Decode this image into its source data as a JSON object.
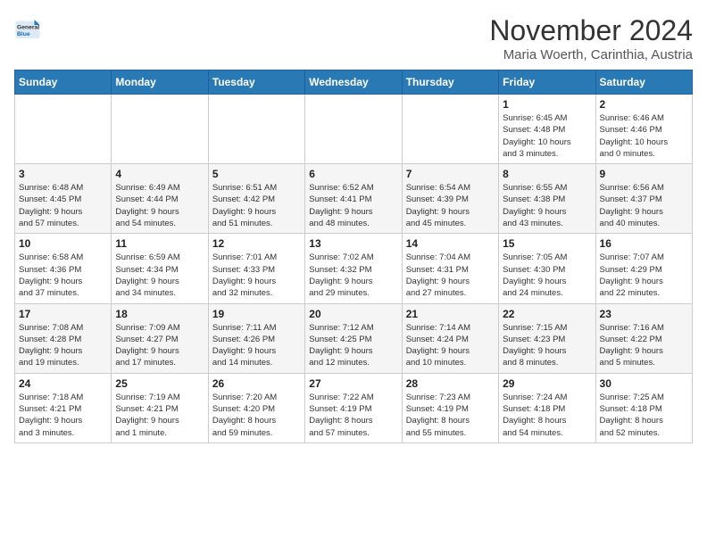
{
  "header": {
    "logo_general": "General",
    "logo_blue": "Blue",
    "month_title": "November 2024",
    "location": "Maria Woerth, Carinthia, Austria"
  },
  "days_of_week": [
    "Sunday",
    "Monday",
    "Tuesday",
    "Wednesday",
    "Thursday",
    "Friday",
    "Saturday"
  ],
  "weeks": [
    [
      {
        "day": "",
        "info": ""
      },
      {
        "day": "",
        "info": ""
      },
      {
        "day": "",
        "info": ""
      },
      {
        "day": "",
        "info": ""
      },
      {
        "day": "",
        "info": ""
      },
      {
        "day": "1",
        "info": "Sunrise: 6:45 AM\nSunset: 4:48 PM\nDaylight: 10 hours\nand 3 minutes."
      },
      {
        "day": "2",
        "info": "Sunrise: 6:46 AM\nSunset: 4:46 PM\nDaylight: 10 hours\nand 0 minutes."
      }
    ],
    [
      {
        "day": "3",
        "info": "Sunrise: 6:48 AM\nSunset: 4:45 PM\nDaylight: 9 hours\nand 57 minutes."
      },
      {
        "day": "4",
        "info": "Sunrise: 6:49 AM\nSunset: 4:44 PM\nDaylight: 9 hours\nand 54 minutes."
      },
      {
        "day": "5",
        "info": "Sunrise: 6:51 AM\nSunset: 4:42 PM\nDaylight: 9 hours\nand 51 minutes."
      },
      {
        "day": "6",
        "info": "Sunrise: 6:52 AM\nSunset: 4:41 PM\nDaylight: 9 hours\nand 48 minutes."
      },
      {
        "day": "7",
        "info": "Sunrise: 6:54 AM\nSunset: 4:39 PM\nDaylight: 9 hours\nand 45 minutes."
      },
      {
        "day": "8",
        "info": "Sunrise: 6:55 AM\nSunset: 4:38 PM\nDaylight: 9 hours\nand 43 minutes."
      },
      {
        "day": "9",
        "info": "Sunrise: 6:56 AM\nSunset: 4:37 PM\nDaylight: 9 hours\nand 40 minutes."
      }
    ],
    [
      {
        "day": "10",
        "info": "Sunrise: 6:58 AM\nSunset: 4:36 PM\nDaylight: 9 hours\nand 37 minutes."
      },
      {
        "day": "11",
        "info": "Sunrise: 6:59 AM\nSunset: 4:34 PM\nDaylight: 9 hours\nand 34 minutes."
      },
      {
        "day": "12",
        "info": "Sunrise: 7:01 AM\nSunset: 4:33 PM\nDaylight: 9 hours\nand 32 minutes."
      },
      {
        "day": "13",
        "info": "Sunrise: 7:02 AM\nSunset: 4:32 PM\nDaylight: 9 hours\nand 29 minutes."
      },
      {
        "day": "14",
        "info": "Sunrise: 7:04 AM\nSunset: 4:31 PM\nDaylight: 9 hours\nand 27 minutes."
      },
      {
        "day": "15",
        "info": "Sunrise: 7:05 AM\nSunset: 4:30 PM\nDaylight: 9 hours\nand 24 minutes."
      },
      {
        "day": "16",
        "info": "Sunrise: 7:07 AM\nSunset: 4:29 PM\nDaylight: 9 hours\nand 22 minutes."
      }
    ],
    [
      {
        "day": "17",
        "info": "Sunrise: 7:08 AM\nSunset: 4:28 PM\nDaylight: 9 hours\nand 19 minutes."
      },
      {
        "day": "18",
        "info": "Sunrise: 7:09 AM\nSunset: 4:27 PM\nDaylight: 9 hours\nand 17 minutes."
      },
      {
        "day": "19",
        "info": "Sunrise: 7:11 AM\nSunset: 4:26 PM\nDaylight: 9 hours\nand 14 minutes."
      },
      {
        "day": "20",
        "info": "Sunrise: 7:12 AM\nSunset: 4:25 PM\nDaylight: 9 hours\nand 12 minutes."
      },
      {
        "day": "21",
        "info": "Sunrise: 7:14 AM\nSunset: 4:24 PM\nDaylight: 9 hours\nand 10 minutes."
      },
      {
        "day": "22",
        "info": "Sunrise: 7:15 AM\nSunset: 4:23 PM\nDaylight: 9 hours\nand 8 minutes."
      },
      {
        "day": "23",
        "info": "Sunrise: 7:16 AM\nSunset: 4:22 PM\nDaylight: 9 hours\nand 5 minutes."
      }
    ],
    [
      {
        "day": "24",
        "info": "Sunrise: 7:18 AM\nSunset: 4:21 PM\nDaylight: 9 hours\nand 3 minutes."
      },
      {
        "day": "25",
        "info": "Sunrise: 7:19 AM\nSunset: 4:21 PM\nDaylight: 9 hours\nand 1 minute."
      },
      {
        "day": "26",
        "info": "Sunrise: 7:20 AM\nSunset: 4:20 PM\nDaylight: 8 hours\nand 59 minutes."
      },
      {
        "day": "27",
        "info": "Sunrise: 7:22 AM\nSunset: 4:19 PM\nDaylight: 8 hours\nand 57 minutes."
      },
      {
        "day": "28",
        "info": "Sunrise: 7:23 AM\nSunset: 4:19 PM\nDaylight: 8 hours\nand 55 minutes."
      },
      {
        "day": "29",
        "info": "Sunrise: 7:24 AM\nSunset: 4:18 PM\nDaylight: 8 hours\nand 54 minutes."
      },
      {
        "day": "30",
        "info": "Sunrise: 7:25 AM\nSunset: 4:18 PM\nDaylight: 8 hours\nand 52 minutes."
      }
    ]
  ]
}
